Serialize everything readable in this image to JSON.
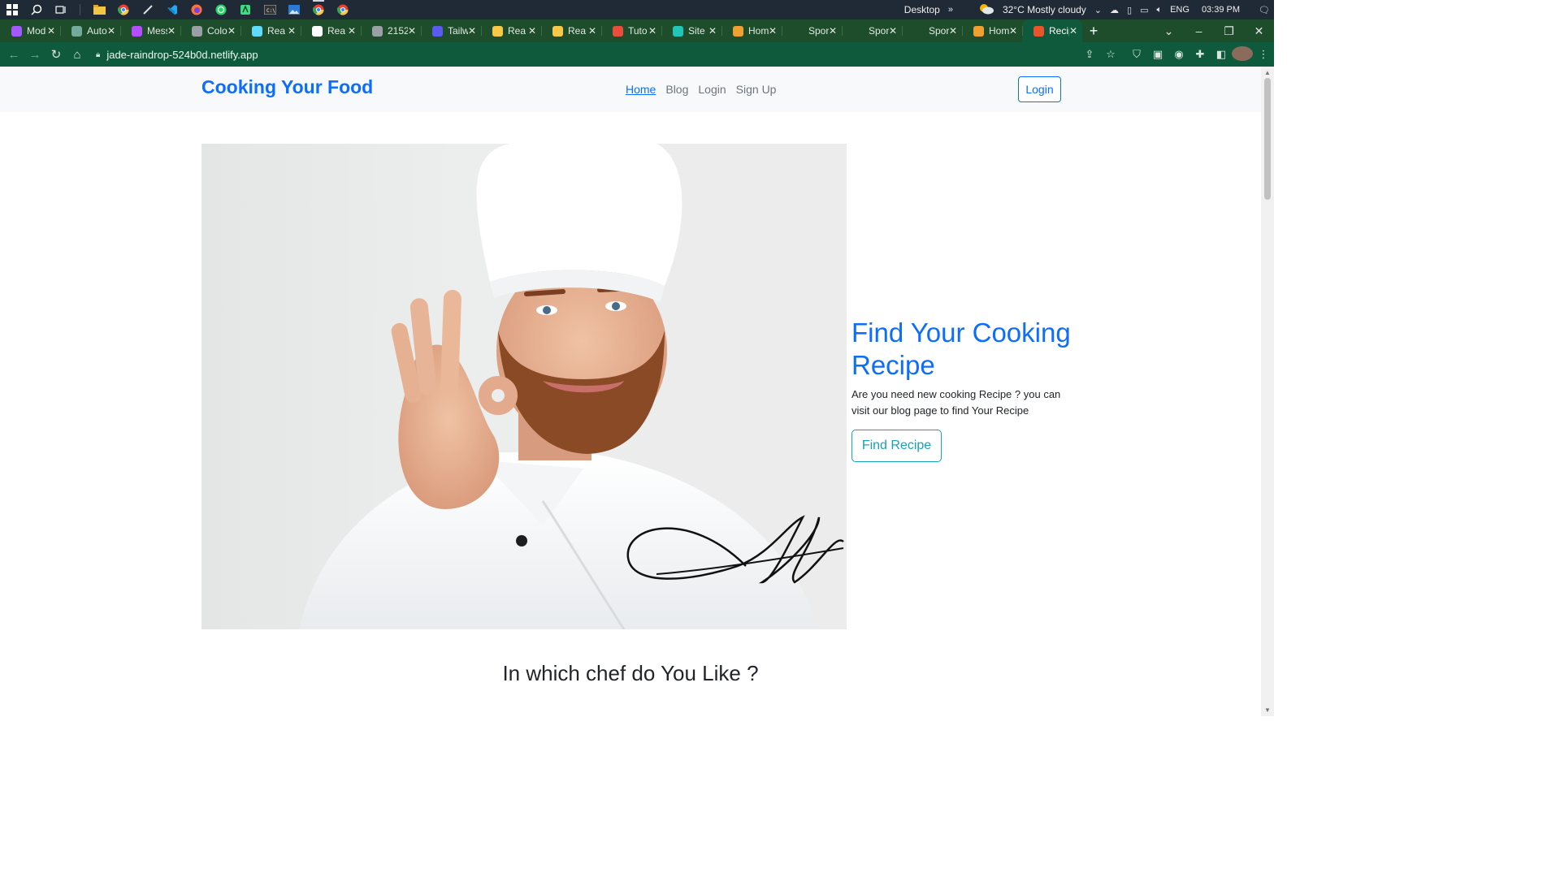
{
  "taskbar": {
    "desktop_label": "Desktop",
    "weather": "32°C  Mostly cloudy",
    "language": "ENG",
    "time": "03:39 PM"
  },
  "tabs": [
    {
      "title": "Mod",
      "color": "#a259ff"
    },
    {
      "title": "Auto",
      "color": "#74aa9c"
    },
    {
      "title": "Mess",
      "color": "#b44dff"
    },
    {
      "title": "Colo",
      "color": "#9aa0a6"
    },
    {
      "title": "Rea",
      "color": "#61dafb"
    },
    {
      "title": "Rea",
      "color": "#ffffff"
    },
    {
      "title": "2152",
      "color": "#9aa0a6"
    },
    {
      "title": "Tailw",
      "color": "#5b5bf0"
    },
    {
      "title": "Rea",
      "color": "#f7c948"
    },
    {
      "title": "Rea",
      "color": "#f7c948"
    },
    {
      "title": "Tuto",
      "color": "#e84d3d"
    },
    {
      "title": "Site",
      "color": "#20c6b6"
    },
    {
      "title": "Hom",
      "color": "#f0a030"
    },
    {
      "title": "Spor",
      "color": "#1e4d2b"
    },
    {
      "title": "Spor",
      "color": "#1e4d2b"
    },
    {
      "title": "Spor",
      "color": "#1e4d2b"
    },
    {
      "title": "Hom",
      "color": "#f0a030"
    },
    {
      "title": "Recip",
      "color": "#e8542b",
      "active": true
    }
  ],
  "address_bar": {
    "url": "jade-raindrop-524b0d.netlify.app"
  },
  "site": {
    "brand": "Cooking Your Food",
    "nav": [
      "Home",
      "Blog",
      "Login",
      "Sign Up"
    ],
    "login_button": "Login",
    "hero": {
      "title": "Find Your Cooking Recipe",
      "description": "Are you need new cooking Recipe ? you can visit our blog page to find Your Recipe",
      "cta": "Find Recipe"
    },
    "section_title": "In which chef do You Like ?"
  }
}
